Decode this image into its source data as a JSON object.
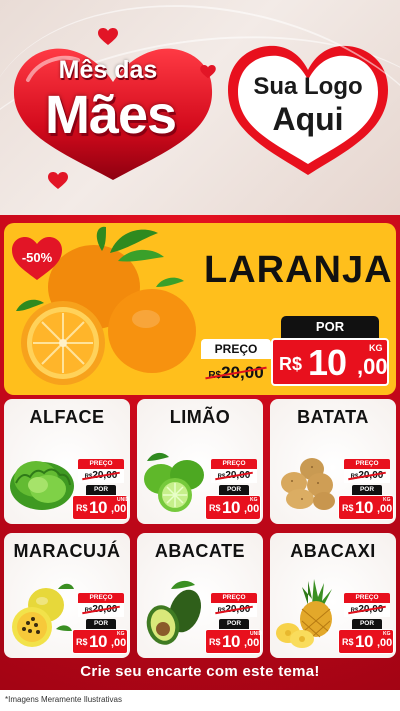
{
  "header": {
    "title_small": "Mês das",
    "title_big": "Mães",
    "logo_line1": "Sua Logo",
    "logo_line2": "Aqui"
  },
  "hero": {
    "discount": "-50%",
    "name": "LARANJA",
    "old_label": "PREÇO",
    "old_currency": "R$",
    "old_price": "20,00",
    "por_label": "POR",
    "currency": "R$",
    "price_int": "10",
    "price_dec": ",00",
    "unit": "KG"
  },
  "products": [
    {
      "name": "ALFACE",
      "icon": "lettuce-icon",
      "preco": "PREÇO",
      "old_currency": "R$",
      "old": "20,00",
      "por": "POR",
      "currency": "R$",
      "int": "10",
      "dec": ",00",
      "unit": "UNID"
    },
    {
      "name": "LIMÃO",
      "icon": "lime-icon",
      "preco": "PREÇO",
      "old_currency": "R$",
      "old": "20,00",
      "por": "POR",
      "currency": "R$",
      "int": "10",
      "dec": ",00",
      "unit": "KG"
    },
    {
      "name": "BATATA",
      "icon": "potato-icon",
      "preco": "PREÇO",
      "old_currency": "R$",
      "old": "20,00",
      "por": "POR",
      "currency": "R$",
      "int": "10",
      "dec": ",00",
      "unit": "KG"
    },
    {
      "name": "MARACUJÁ",
      "icon": "passion-fruit-icon",
      "preco": "PREÇO",
      "old_currency": "R$",
      "old": "20,00",
      "por": "POR",
      "currency": "R$",
      "int": "10",
      "dec": ",00",
      "unit": "KG"
    },
    {
      "name": "ABACATE",
      "icon": "avocado-icon",
      "preco": "PREÇO",
      "old_currency": "R$",
      "old": "20,00",
      "por": "POR",
      "currency": "R$",
      "int": "10",
      "dec": ",00",
      "unit": "UNID"
    },
    {
      "name": "ABACAXI",
      "icon": "pineapple-icon",
      "preco": "PREÇO",
      "old_currency": "R$",
      "old": "20,00",
      "por": "POR",
      "currency": "R$",
      "int": "10",
      "dec": ",00",
      "unit": "KG"
    }
  ],
  "cta": "Crie seu encarte com este tema!",
  "footnote": "*Imagens Meramente Ilustrativas",
  "colors": {
    "accent_red": "#e8101d",
    "banner_yellow": "#ffbf1c",
    "background_red": "#c4081a"
  }
}
